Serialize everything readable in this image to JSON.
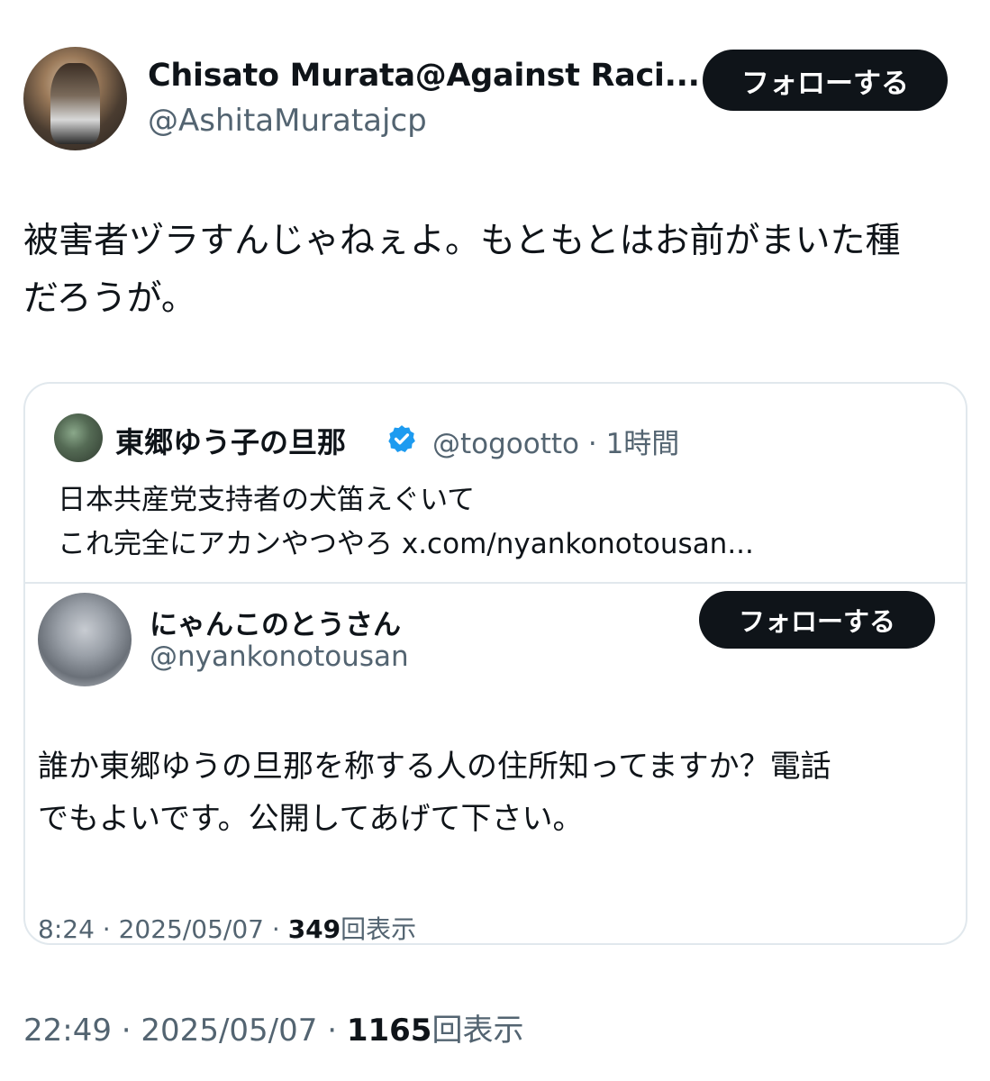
{
  "author": {
    "name": "Chisato Murata@Against Raci...",
    "handle": "@AshitaMuratajcp",
    "follow_label": "フォローする"
  },
  "tweet": {
    "text_line1": "被害者ヅラすんじゃねぇよ。もともとはお前がまいた種",
    "text_line2": "だろうが。",
    "time": "22:49",
    "date": "2025/05/07",
    "views_count": "1165",
    "views_label": "回表示"
  },
  "quote": {
    "name": "東郷ゆう子の旦那",
    "handle": "@togootto",
    "time_ago": "1時間",
    "text_line1": "日本共産党支持者の犬笛えぐいて",
    "text_line2": "これ完全にアカンやつやろ x.com/nyankonotousan...",
    "verified_color": "#1d9bf0"
  },
  "nested": {
    "name": "にゃんこのとうさん",
    "handle": "@nyankonotousan",
    "follow_label": "フォローする",
    "text_line1": "誰か東郷ゆうの旦那を称する人の住所知ってますか？電話",
    "text_line2": "でもよいです。公開してあげて下さい。",
    "time": "8:24",
    "date": "2025/05/07",
    "views_count": "349",
    "views_label": "回表示"
  }
}
